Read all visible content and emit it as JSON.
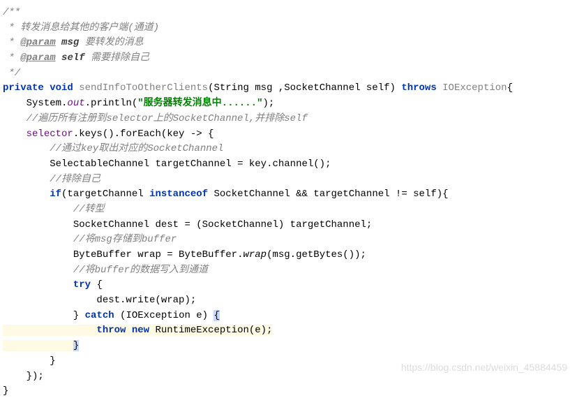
{
  "lines": {
    "l01": "/**",
    "l02_pre": " * ",
    "l02_txt": "转发消息给其他的客户端(通道)",
    "l03_pre": " * ",
    "l03_tag": "@param",
    "l03_name": " msg",
    "l03_desc": " 要转发的消息",
    "l04_pre": " * ",
    "l04_tag": "@param",
    "l04_name": " self",
    "l04_desc": " 需要排除自己",
    "l05": " */",
    "l06_private": "private",
    "l06_void": " void",
    "l06_method": " sendInfoToOtherClients",
    "l06_sig": "(String msg ,SocketChannel self) ",
    "l06_throws": "throws",
    "l06_ex": " IOException",
    "l07_ind": "    ",
    "l07_sys": "System.",
    "l07_out": "out",
    "l07_println": ".println(",
    "l07_str": "\"服务器转发消息中......\"",
    "l07_end": ");",
    "l08_ind": "    ",
    "l08_txt": "//遍历所有注册到selector上的SocketChannel,并排除self",
    "l09_ind": "    ",
    "l09_sel": "selector",
    "l09_keys": ".keys().forEach(key -> {",
    "l10_ind": "        ",
    "l10_txt": "//通过key取出对应的SocketChannel",
    "l11_ind": "        ",
    "l11_txt": "SelectableChannel targetChannel = key.channel();",
    "l12_ind": "        ",
    "l12_txt": "//排除自己",
    "l13_ind": "        ",
    "l13_if": "if",
    "l13_a": "(targetChannel ",
    "l13_inst": "instanceof",
    "l13_b": " SocketChannel && targetChannel != self){",
    "l14_ind": "            ",
    "l14_txt": "//转型",
    "l15_ind": "            ",
    "l15_txt": "SocketChannel dest = (SocketChannel) targetChannel;",
    "l16_ind": "            ",
    "l16_txt": "//将msg存储到buffer",
    "l17_ind": "            ",
    "l17_a": "ByteBuffer wrap = ByteBuffer.",
    "l17_wrap": "wrap",
    "l17_b": "(msg.getBytes());",
    "l18_ind": "            ",
    "l18_txt": "//将buffer的数据写入到通道",
    "l19_ind": "            ",
    "l19_try": "try",
    "l19_b": " {",
    "l20_ind": "                ",
    "l20_txt": "dest.write(wrap);",
    "l21_ind": "            ",
    "l21_b1": "} ",
    "l21_catch": "catch",
    "l21_b2": " (IOException e) ",
    "l21_brace": "{",
    "l22_ind": "                ",
    "l22_throw": "throw new",
    "l22_b": " RuntimeException(e);",
    "l23_ind": "            ",
    "l23_brace": "}",
    "l24_ind": "        ",
    "l24_b": "}",
    "l25_ind": "    ",
    "l25_b": "});",
    "l26": "}"
  },
  "watermark": "https://blog.csdn.net/weixin_45884459"
}
